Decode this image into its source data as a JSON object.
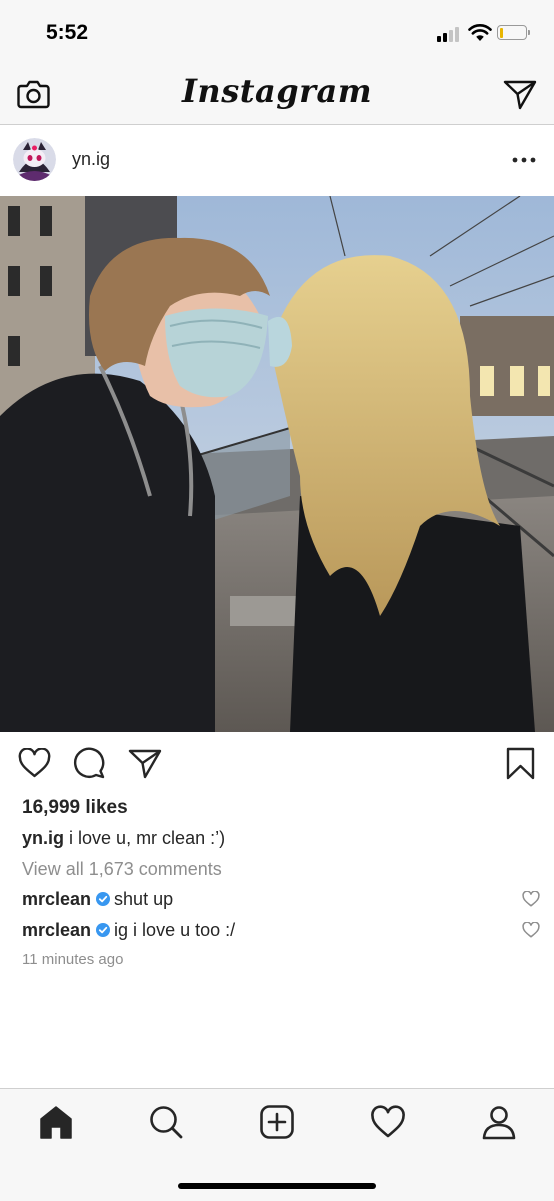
{
  "status_bar": {
    "time": "5:52",
    "icons": [
      "cellular-signal-icon",
      "wifi-icon",
      "battery-low-icon"
    ],
    "battery_color": "#e8b500"
  },
  "top_bar": {
    "brand": "Instagram",
    "left_icon": "camera-icon",
    "right_icon": "direct-message-icon"
  },
  "post": {
    "username": "yn.ig",
    "avatar_icon": "profile-avatar",
    "more_icon": "more-options-icon",
    "photo": "couple-in-face-masks-kissing-at-tram-stop",
    "actions": [
      "like-icon",
      "comment-icon",
      "share-icon",
      "bookmark-icon"
    ],
    "likes": "16,999 likes",
    "caption": {
      "username": "yn.ig",
      "text": "i love u, mr clean :’)"
    },
    "view_all_comments": "View all 1,673 comments",
    "comments": [
      {
        "username": "mrclean",
        "verified": true,
        "text": "shut up"
      },
      {
        "username": "mrclean",
        "verified": true,
        "text": "ig i love u too :/"
      }
    ],
    "timestamp": "11 minutes ago"
  },
  "tab_bar": {
    "items": [
      "home-icon",
      "search-icon",
      "new-post-icon",
      "activity-icon",
      "profile-icon"
    ],
    "active": "home-icon"
  },
  "colors": {
    "verified_badge": "#3897f0",
    "text_primary": "#262626",
    "text_secondary": "#8e8e8e"
  }
}
